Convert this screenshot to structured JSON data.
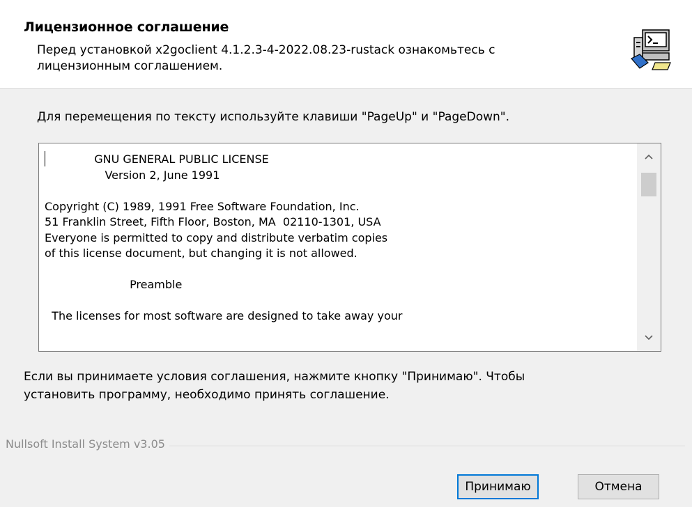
{
  "header": {
    "title": "Лицензионное соглашение",
    "subtitle": "Перед установкой x2goclient 4.1.2.3-4-2022.08.23-rustack ознакомьтесь с\nлицензионным соглашением.",
    "icon": "installer-computer-icon"
  },
  "instruction": "Для перемещения по тексту используйте клавиши \"PageUp\" и \"PageDown\".",
  "license": {
    "text": "              GNU GENERAL PUBLIC LICENSE\n                 Version 2, June 1991\n\nCopyright (C) 1989, 1991 Free Software Foundation, Inc.\n51 Franklin Street, Fifth Floor, Boston, MA  02110-1301, USA\nEveryone is permitted to copy and distribute verbatim copies\nof this license document, but changing it is not allowed.\n\n                        Preamble\n\n  The licenses for most software are designed to take away your",
    "scrollbar": {
      "up_icon": "chevron-up-icon",
      "down_icon": "chevron-down-icon"
    }
  },
  "agree_text": "Если вы принимаете условия соглашения, нажмите кнопку \"Принимаю\". Чтобы\nустановить программу, необходимо принять соглашение.",
  "branding": "Nullsoft Install System v3.05",
  "buttons": {
    "accept": "Принимаю",
    "cancel": "Отмена"
  },
  "colors": {
    "header_bg": "#ffffff",
    "dialog_bg": "#f0f0f0",
    "focus_border": "#0078d7",
    "branding_text": "#8c8c8c"
  }
}
